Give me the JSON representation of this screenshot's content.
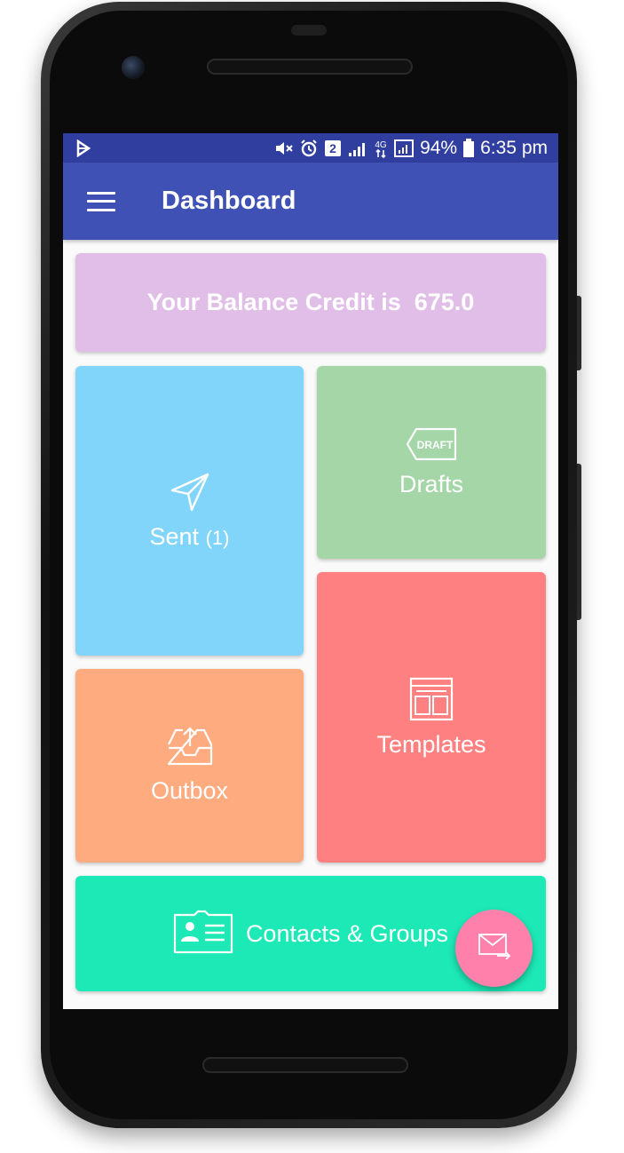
{
  "status_bar": {
    "network_label": "4G",
    "sim_label": "2",
    "battery": "94%",
    "time": "6:35 pm"
  },
  "toolbar": {
    "title": "Dashboard",
    "menu_icon": "hamburger-menu-icon"
  },
  "balance": {
    "text": "Your Balance Credit is  675.0"
  },
  "tiles": {
    "sent": {
      "label": "Sent",
      "count": "(1)",
      "icon": "send-paper-plane-icon"
    },
    "drafts": {
      "label": "Drafts",
      "icon": "draft-tag-icon",
      "icon_text": "DRAFT"
    },
    "templates": {
      "label": "Templates",
      "icon": "template-layout-icon"
    },
    "outbox": {
      "label": "Outbox",
      "icon": "outbox-tray-icon"
    },
    "contacts": {
      "label": "Contacts & Groups",
      "icon": "contact-card-icon"
    }
  },
  "fab": {
    "icon": "compose-mail-icon"
  },
  "colors": {
    "status_bar": "#303f9f",
    "toolbar": "#3f51b5",
    "balance": "#e1bee7",
    "sent": "#81d4fa",
    "drafts": "#a5d6a7",
    "templates": "#ff8080",
    "outbox": "#ffab80",
    "contacts": "#1de9b6",
    "fab": "#ff80ab"
  }
}
